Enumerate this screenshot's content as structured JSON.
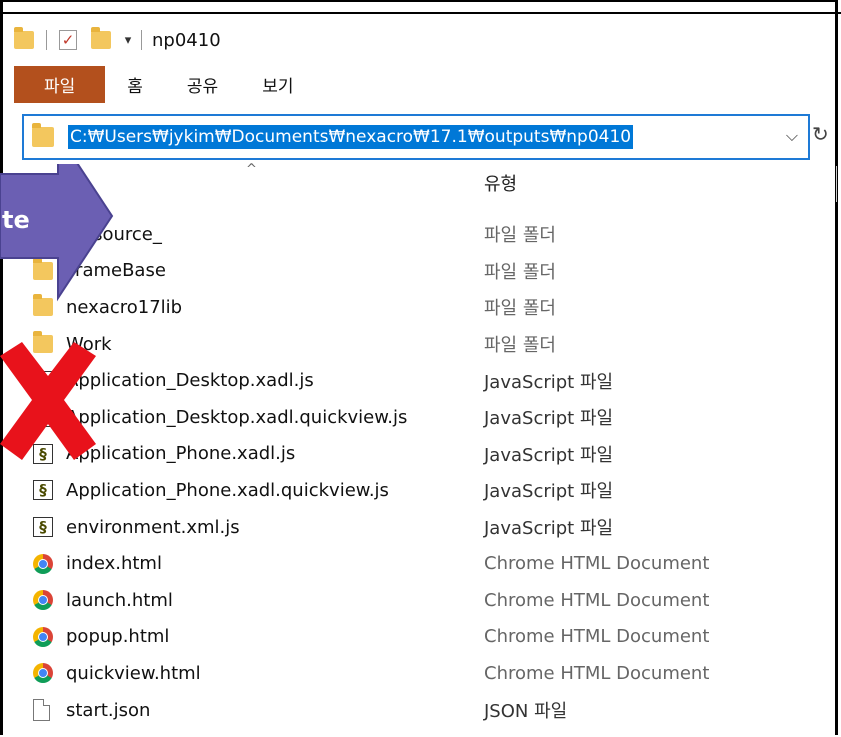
{
  "window": {
    "title": "np0410"
  },
  "ribbon": {
    "tabs": [
      "파일",
      "홈",
      "공유",
      "보기"
    ]
  },
  "address_bar": {
    "path": "C:₩Users₩jykim₩Documents₩nexacro₩17.1₩outputs₩np0410"
  },
  "columns": {
    "type_header": "유형"
  },
  "files": [
    {
      "name": "_resource_",
      "type": "파일 폴더",
      "icon": "folder-icon"
    },
    {
      "name": "FrameBase",
      "type": "파일 폴더",
      "icon": "folder-icon"
    },
    {
      "name": "nexacro17lib",
      "type": "파일 폴더",
      "icon": "folder-icon"
    },
    {
      "name": "Work",
      "type": "파일 폴더",
      "icon": "folder-icon"
    },
    {
      "name": "Application_Desktop.xadl.js",
      "type": "JavaScript 파일",
      "icon": "js-file-icon"
    },
    {
      "name": "Application_Desktop.xadl.quickview.js",
      "type": "JavaScript 파일",
      "icon": "js-file-icon"
    },
    {
      "name": "Application_Phone.xadl.js",
      "type": "JavaScript 파일",
      "icon": "js-file-icon"
    },
    {
      "name": "Application_Phone.xadl.quickview.js",
      "type": "JavaScript 파일",
      "icon": "js-file-icon"
    },
    {
      "name": "environment.xml.js",
      "type": "JavaScript 파일",
      "icon": "js-file-icon"
    },
    {
      "name": "index.html",
      "type": "Chrome HTML Document",
      "icon": "chrome-icon"
    },
    {
      "name": "launch.html",
      "type": "Chrome HTML Document",
      "icon": "chrome-icon"
    },
    {
      "name": "popup.html",
      "type": "Chrome HTML Document",
      "icon": "chrome-icon"
    },
    {
      "name": "quickview.html",
      "type": "Chrome HTML Document",
      "icon": "chrome-icon"
    },
    {
      "name": "start.json",
      "type": "JSON 파일",
      "icon": "file-icon"
    }
  ],
  "overlay": {
    "arrow_label": "te"
  },
  "colors": {
    "file_tab": "#b3501d",
    "address_highlight": "#0078d7",
    "arrow": "#6b5fb3",
    "x_mark": "#e8121b"
  }
}
